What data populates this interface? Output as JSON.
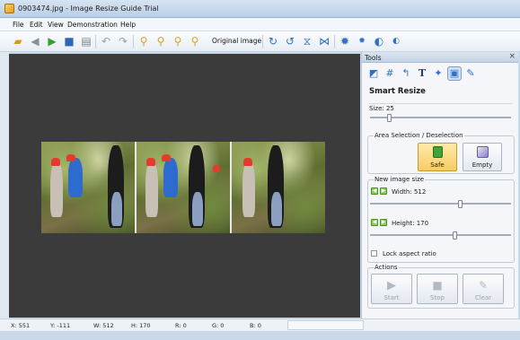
{
  "window": {
    "title": "0903474.jpg - Image Resize Guide Trial"
  },
  "menubar": {
    "items": [
      "File",
      "Edit",
      "View",
      "Demonstration",
      "Help"
    ]
  },
  "toolbar": {
    "original_image_label": "Original image"
  },
  "tools_panel": {
    "header": "Tools",
    "close_glyph": "×",
    "section_title": "Smart Resize",
    "size_label": "Size: 25",
    "size_value": 25,
    "area_selection": {
      "title": "Area Selection / Deselection",
      "safe_label": "Safe",
      "empty_label": "Empty"
    },
    "new_image_size": {
      "title": "New image size",
      "width_label": "Width: 512",
      "width_value": 512,
      "height_label": "Height: 170",
      "height_value": 170,
      "lock_label": "Lock aspect ratio"
    },
    "actions": {
      "title": "Actions",
      "start_label": "Start",
      "stop_label": "Stop",
      "clear_label": "Clear"
    }
  },
  "statusbar": {
    "x": "X: 551",
    "y": "Y: -111",
    "w": "W: 512",
    "h": "H: 170",
    "r": "R: 0",
    "g": "G: 0",
    "b": "B: 0"
  },
  "colors": {
    "canvas": "#3b3b3b",
    "accent_blue": "#2f6fc7",
    "safe_green": "#3fa33a"
  }
}
